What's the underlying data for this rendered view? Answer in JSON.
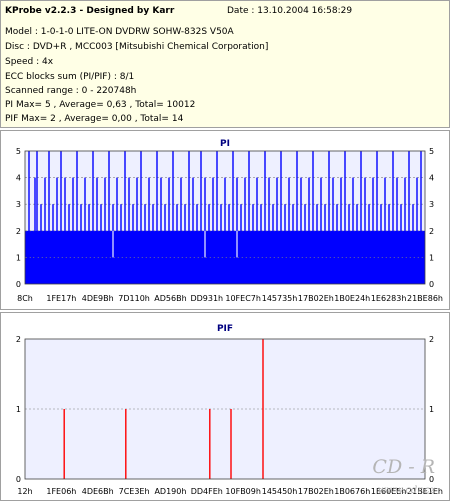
{
  "info": {
    "title": "KProbe v2.2.3 - Designed by Karr",
    "date": "Date : 13.10.2004 16:58:29",
    "model": "Model : 1-0-1-0 LITE-ON DVDRW SOHW-832S  V50A",
    "disc": "Disc : DVD+R , MCC003 [Mitsubishi Chemical Corporation]",
    "speed": "Speed : 4x",
    "ecc": "ECC blocks sum (PI/PIF) : 8/1",
    "range": "Scanned range : 0 - 220748h",
    "pi_stats": "PI Max= 5 , Average= 0,63 , Total= 10012",
    "pif_stats": "PIF Max= 2 , Average= 0,00 , Total= 14"
  },
  "chart_data": [
    {
      "type": "bar",
      "title": "PI",
      "xlabel": "",
      "ylabel": "",
      "ylim": [
        0,
        5
      ],
      "yticks": [
        0,
        1,
        2,
        3,
        4,
        5
      ],
      "x_tick_labels": [
        "8Ch",
        "1FE17h",
        "4DE9Bh",
        "7D110h",
        "AD56Bh",
        "DD931h",
        "10FEC7h",
        "145735h",
        "17B02Eh",
        "1B0E24h",
        "1E6283h",
        "21BE86h"
      ],
      "base_level": 2,
      "spikes": [
        {
          "x": 0.01,
          "y": 5
        },
        {
          "x": 0.025,
          "y": 4
        },
        {
          "x": 0.03,
          "y": 5
        },
        {
          "x": 0.04,
          "y": 3
        },
        {
          "x": 0.05,
          "y": 4
        },
        {
          "x": 0.06,
          "y": 5
        },
        {
          "x": 0.07,
          "y": 3
        },
        {
          "x": 0.08,
          "y": 4
        },
        {
          "x": 0.09,
          "y": 5
        },
        {
          "x": 0.1,
          "y": 4
        },
        {
          "x": 0.11,
          "y": 3
        },
        {
          "x": 0.12,
          "y": 4
        },
        {
          "x": 0.13,
          "y": 5
        },
        {
          "x": 0.14,
          "y": 3
        },
        {
          "x": 0.15,
          "y": 4
        },
        {
          "x": 0.16,
          "y": 3
        },
        {
          "x": 0.17,
          "y": 5
        },
        {
          "x": 0.18,
          "y": 4
        },
        {
          "x": 0.19,
          "y": 3
        },
        {
          "x": 0.2,
          "y": 4
        },
        {
          "x": 0.21,
          "y": 5
        },
        {
          "x": 0.22,
          "y": 3
        },
        {
          "x": 0.23,
          "y": 4
        },
        {
          "x": 0.24,
          "y": 3
        },
        {
          "x": 0.25,
          "y": 5
        },
        {
          "x": 0.26,
          "y": 4
        },
        {
          "x": 0.27,
          "y": 3
        },
        {
          "x": 0.28,
          "y": 4
        },
        {
          "x": 0.29,
          "y": 5
        },
        {
          "x": 0.3,
          "y": 3
        },
        {
          "x": 0.31,
          "y": 4
        },
        {
          "x": 0.32,
          "y": 3
        },
        {
          "x": 0.33,
          "y": 5
        },
        {
          "x": 0.34,
          "y": 4
        },
        {
          "x": 0.35,
          "y": 3
        },
        {
          "x": 0.36,
          "y": 4
        },
        {
          "x": 0.37,
          "y": 5
        },
        {
          "x": 0.38,
          "y": 3
        },
        {
          "x": 0.39,
          "y": 4
        },
        {
          "x": 0.4,
          "y": 3
        },
        {
          "x": 0.41,
          "y": 5
        },
        {
          "x": 0.42,
          "y": 4
        },
        {
          "x": 0.43,
          "y": 3
        },
        {
          "x": 0.44,
          "y": 5
        },
        {
          "x": 0.45,
          "y": 4
        },
        {
          "x": 0.46,
          "y": 3
        },
        {
          "x": 0.47,
          "y": 4
        },
        {
          "x": 0.48,
          "y": 5
        },
        {
          "x": 0.49,
          "y": 3
        },
        {
          "x": 0.5,
          "y": 4
        },
        {
          "x": 0.51,
          "y": 3
        },
        {
          "x": 0.52,
          "y": 5
        },
        {
          "x": 0.53,
          "y": 4
        },
        {
          "x": 0.54,
          "y": 3
        },
        {
          "x": 0.55,
          "y": 4
        },
        {
          "x": 0.56,
          "y": 5
        },
        {
          "x": 0.57,
          "y": 3
        },
        {
          "x": 0.58,
          "y": 4
        },
        {
          "x": 0.59,
          "y": 3
        },
        {
          "x": 0.6,
          "y": 5
        },
        {
          "x": 0.61,
          "y": 4
        },
        {
          "x": 0.62,
          "y": 3
        },
        {
          "x": 0.63,
          "y": 4
        },
        {
          "x": 0.64,
          "y": 5
        },
        {
          "x": 0.65,
          "y": 3
        },
        {
          "x": 0.66,
          "y": 4
        },
        {
          "x": 0.67,
          "y": 3
        },
        {
          "x": 0.68,
          "y": 5
        },
        {
          "x": 0.69,
          "y": 4
        },
        {
          "x": 0.7,
          "y": 3
        },
        {
          "x": 0.71,
          "y": 4
        },
        {
          "x": 0.72,
          "y": 5
        },
        {
          "x": 0.73,
          "y": 3
        },
        {
          "x": 0.74,
          "y": 4
        },
        {
          "x": 0.75,
          "y": 3
        },
        {
          "x": 0.76,
          "y": 5
        },
        {
          "x": 0.77,
          "y": 4
        },
        {
          "x": 0.78,
          "y": 3
        },
        {
          "x": 0.79,
          "y": 4
        },
        {
          "x": 0.8,
          "y": 5
        },
        {
          "x": 0.81,
          "y": 3
        },
        {
          "x": 0.82,
          "y": 4
        },
        {
          "x": 0.83,
          "y": 3
        },
        {
          "x": 0.84,
          "y": 5
        },
        {
          "x": 0.85,
          "y": 4
        },
        {
          "x": 0.86,
          "y": 3
        },
        {
          "x": 0.87,
          "y": 4
        },
        {
          "x": 0.88,
          "y": 5
        },
        {
          "x": 0.89,
          "y": 3
        },
        {
          "x": 0.9,
          "y": 4
        },
        {
          "x": 0.91,
          "y": 3
        },
        {
          "x": 0.92,
          "y": 5
        },
        {
          "x": 0.93,
          "y": 4
        },
        {
          "x": 0.94,
          "y": 3
        },
        {
          "x": 0.95,
          "y": 4
        },
        {
          "x": 0.96,
          "y": 5
        },
        {
          "x": 0.97,
          "y": 3
        },
        {
          "x": 0.98,
          "y": 4
        },
        {
          "x": 0.99,
          "y": 5
        }
      ],
      "dips": [
        {
          "x": 0.22,
          "y": 1
        },
        {
          "x": 0.45,
          "y": 1
        },
        {
          "x": 0.53,
          "y": 1
        }
      ],
      "colors": {
        "bar": "#0000ff",
        "plot_bg": "#eef0ff",
        "grid": "#808080",
        "title": "#000080",
        "frame": "#404040"
      }
    },
    {
      "type": "bar",
      "title": "PIF",
      "xlabel": "",
      "ylabel": "",
      "ylim": [
        0,
        2
      ],
      "yticks": [
        0,
        1,
        2
      ],
      "x_tick_labels": [
        "12h",
        "1FE06h",
        "4DE6Bh",
        "7CE3Eh",
        "AD190h",
        "DD4FEh",
        "10FB09h",
        "145450h",
        "17B02Eh",
        "1B0676h",
        "1E60EEh",
        "21BE1Eh"
      ],
      "spikes": [
        {
          "x": 0.098,
          "y": 1
        },
        {
          "x": 0.252,
          "y": 1
        },
        {
          "x": 0.462,
          "y": 1
        },
        {
          "x": 0.515,
          "y": 1
        },
        {
          "x": 0.595,
          "y": 2
        }
      ],
      "colors": {
        "bar": "#ff0000",
        "plot_bg": "#eef0ff",
        "grid": "#808080",
        "title": "#000080",
        "frame": "#404040"
      }
    }
  ],
  "watermark": {
    "brand": "CD - R",
    "url": "www.cdr.cz"
  }
}
